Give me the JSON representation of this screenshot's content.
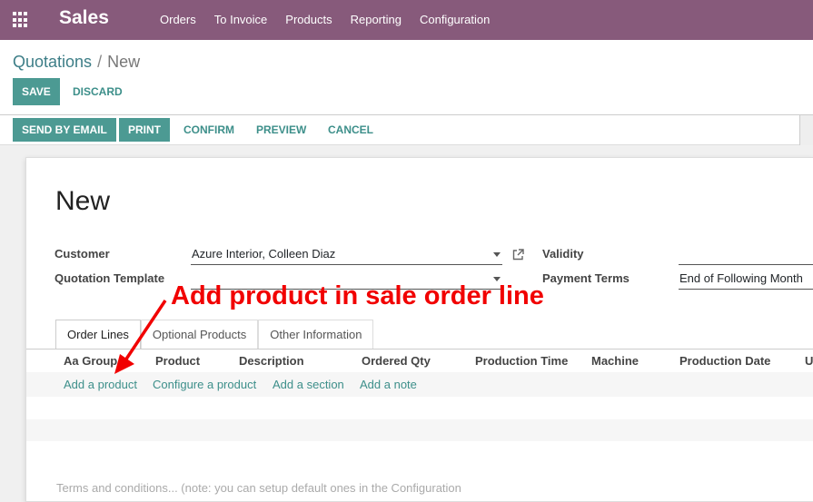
{
  "topbar": {
    "app_name": "Sales",
    "menu": [
      "Orders",
      "To Invoice",
      "Products",
      "Reporting",
      "Configuration"
    ],
    "bg_color": "#875a7b",
    "apps_icon": "grid-icon"
  },
  "breadcrumb": {
    "parent": "Quotations",
    "separator": "/",
    "current": "New"
  },
  "buttons": {
    "save": "SAVE",
    "discard": "DISCARD"
  },
  "statusbar": {
    "send_by_email": "SEND BY EMAIL",
    "print": "PRINT",
    "confirm": "CONFIRM",
    "preview": "PREVIEW",
    "cancel": "CANCEL"
  },
  "form": {
    "title": "New",
    "customer_label": "Customer",
    "customer_value": "Azure Interior, Colleen Diaz",
    "template_label": "Quotation Template",
    "template_value": "",
    "validity_label": "Validity",
    "validity_value": "",
    "payment_terms_label": "Payment Terms",
    "payment_terms_value": "End of Following Month",
    "external_link_icon": "external-link-icon"
  },
  "tabs": [
    "Order Lines",
    "Optional Products",
    "Other Information"
  ],
  "order_lines": {
    "headers": [
      "Aa Group",
      "Product",
      "Description",
      "Ordered Qty",
      "Production Time",
      "Machine",
      "Production Date",
      "U"
    ],
    "add_links": [
      "Add a product",
      "Configure a product",
      "Add a section",
      "Add a note"
    ]
  },
  "terms_placeholder": "Terms and conditions... (note: you can setup default ones in the Configuration",
  "annotation": {
    "text": "Add product in sale order line",
    "color": "#f10000"
  }
}
